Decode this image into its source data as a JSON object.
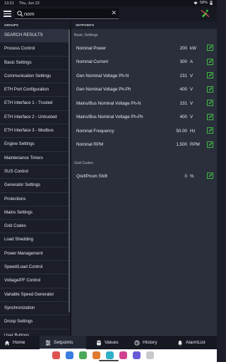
{
  "status_bar": {
    "time": "13:21",
    "date": "Thu, Jun 22",
    "battery": "58%"
  },
  "search": {
    "value": "nom",
    "placeholder": "Search"
  },
  "groups_header": "GROUPS",
  "setpoints_header": "SETPOINTS",
  "groups": [
    "SEARCH RESULTS",
    "Process Control",
    "Basic Settings",
    "Communication Settings",
    "ETH Port Configuration",
    "ETH Interface 1 - Trusted",
    "ETH Interface 2 - Untrusted",
    "ETH Interface 3 - Modbus",
    "Engine Settings",
    "Maintenance Timers",
    "SUS Control",
    "Generator Settings",
    "Protections",
    "Mains Settings",
    "Grid Codes",
    "Load Shedding",
    "Power Management",
    "Speed/Load Control",
    "Voltage/PF Control",
    "Variable Speed Generator",
    "Synchronization",
    "Droop Settings",
    "User Buttons"
  ],
  "sections": [
    {
      "title": "Basic Settings",
      "rows": [
        {
          "name": "Nominal Power",
          "value": "200",
          "unit": "kW"
        },
        {
          "name": "Nominal Current",
          "value": "300",
          "unit": "A"
        },
        {
          "name": "Gen Nominal Voltage Ph-N",
          "value": "231",
          "unit": "V"
        },
        {
          "name": "Gen Nominal Voltage Ph-Ph",
          "value": "400",
          "unit": "V"
        },
        {
          "name": "Mains/Bus Nominal Voltage Ph-N",
          "value": "231",
          "unit": "V"
        },
        {
          "name": "Mains/Bus Nominal Voltage Ph-Ph",
          "value": "400",
          "unit": "V"
        },
        {
          "name": "Nominal Frequency",
          "value": "50.00",
          "unit": "Hz"
        },
        {
          "name": "Nominal RPM",
          "value": "1,500",
          "unit": "RPM"
        }
      ]
    },
    {
      "title": "Grid Codes",
      "rows": [
        {
          "name": "Qref/Pnom Shift",
          "value": "0",
          "unit": "%"
        }
      ]
    }
  ],
  "bottom_nav": [
    {
      "label": "Home",
      "icon": "home-icon"
    },
    {
      "label": "Setpoints",
      "icon": "sliders-icon",
      "active": true
    },
    {
      "label": "Values",
      "icon": "database-icon"
    },
    {
      "label": "History",
      "icon": "history-icon"
    },
    {
      "label": "AlarmList",
      "icon": "bell-icon"
    }
  ],
  "colors": {
    "accent_green": "#3fbf3f",
    "panel_bg": "#2b2f3c",
    "bg": "#1b1e28",
    "active_group": "#2d3140"
  }
}
